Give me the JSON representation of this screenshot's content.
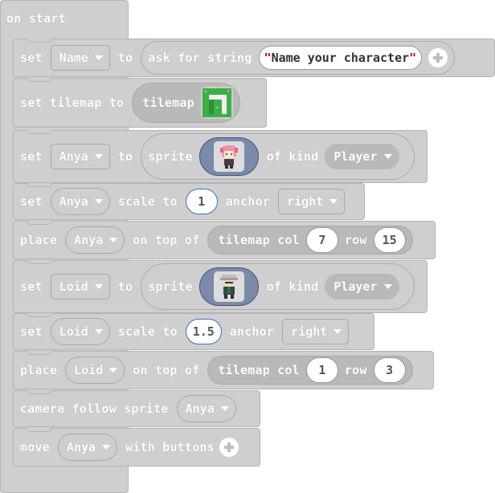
{
  "on_start": {
    "label": "on start"
  },
  "blocks": {
    "set_name": {
      "set": "set",
      "var": "Name",
      "to": "to",
      "ask": "ask for string",
      "prompt_value": "Name your character"
    },
    "set_tilemap": {
      "label": "set tilemap to",
      "reporter": "tilemap"
    },
    "set_anya": {
      "set": "set",
      "var": "Anya",
      "to": "to",
      "sprite": "sprite",
      "of_kind": "of kind",
      "kind": "Player"
    },
    "anya_scale": {
      "set": "set",
      "var": "Anya",
      "scale_to": "scale to",
      "scale": "1",
      "anchor": "anchor",
      "anchor_value": "right"
    },
    "place_anya": {
      "place": "place",
      "var": "Anya",
      "on_top_of": "on top of",
      "tilemap_col": "tilemap col",
      "col": "7",
      "row": "row",
      "row_value": "15"
    },
    "set_loid": {
      "set": "set",
      "var": "Loid",
      "to": "to",
      "sprite": "sprite",
      "of_kind": "of kind",
      "kind": "Player"
    },
    "loid_scale": {
      "set": "set",
      "var": "Loid",
      "scale_to": "scale to",
      "scale": "1.5",
      "anchor": "anchor",
      "anchor_value": "right"
    },
    "place_loid": {
      "place": "place",
      "var": "Loid",
      "on_top_of": "on top of",
      "tilemap_col": "tilemap col",
      "col": "1",
      "row": "row",
      "row_value": "3"
    },
    "camera": {
      "label": "camera follow sprite",
      "var": "Anya"
    },
    "move": {
      "move": "move",
      "var": "Anya",
      "with_buttons": "with buttons"
    }
  },
  "icons": {
    "add": "plus-circle-icon",
    "dropdown": "chevron-down-icon",
    "tilemap": "tilemap-thumbnail",
    "anya": "anya-sprite-thumbnail",
    "loid": "loid-sprite-thumbnail"
  },
  "colors": {
    "block": "#cfcfcf",
    "reporter_dark": "#b9b9b9",
    "sprite_picker": "#7b8aa8",
    "string_quote": "#a31515",
    "highlight": "#3b6fd3"
  }
}
